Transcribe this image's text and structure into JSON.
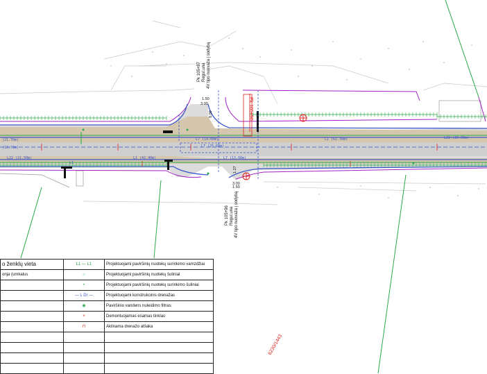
{
  "drawing": {
    "pk_top": {
      "line1": "Pk 105+87",
      "line2": "Regul.una",
      "line3": "4V tipo nuovaža į sodybą"
    },
    "pk_bottom": {
      "line1": "Pk 105+96",
      "line2": "Regul.una",
      "line3": "4V tipo nuovaža į sodybą"
    },
    "station_box": "Pk 105+90",
    "stamp": "6230/1443",
    "dims": {
      "top_a": "1.50",
      "top_b": "3.00",
      "bot_a": "3.00",
      "bot_b": "1.50",
      "v_a": "8.00",
      "v_b": "1.27"
    },
    "lines": {
      "l1_61": "L1 (61.30m)",
      "l1_42": "L1 (42.40m)",
      "l7_19": "L7 (19.00m)",
      "l7_25": "L7 (25.60m)",
      "l7_13": "L7 (13.00m)",
      "l22_left": "L22 (21.50m)",
      "l22_right": "L22 (20.00m)",
      "left_a": "(21.70m)",
      "left_b": "(10.70m)",
      "l1_short": "L1"
    }
  },
  "legend": {
    "left_rows": [
      "o ženklų vieta",
      "onja (umkalus",
      "",
      "",
      "",
      "",
      "",
      "",
      "",
      "",
      ""
    ],
    "items": [
      {
        "symbol": "L1 — L1",
        "text": "Projektuojami paviršinių nuotekų surinkimo vamzdžiai"
      },
      {
        "symbol": "○",
        "text": "Projektuojami paviršinių nuotekų šuliniai"
      },
      {
        "symbol": "•",
        "text": "Projektuojami paviršinių nuotekų surinkimo šuliniai"
      },
      {
        "symbol": "— L Dr —",
        "text": "Projektuojami konstrukcinis drenažas"
      },
      {
        "symbol": "◉",
        "text": "Paviršinio vandens nuleidimo filtras"
      },
      {
        "symbol": "×",
        "text": "Demontuojamas esamas tinklas"
      },
      {
        "symbol": "⊓",
        "text": "Aklinama drenažo atšaka"
      }
    ],
    "colors": {
      "pipe": "#2aa84a",
      "demolish": "#e02020",
      "road": "#3a56c8",
      "curb": "#a020c0"
    }
  }
}
